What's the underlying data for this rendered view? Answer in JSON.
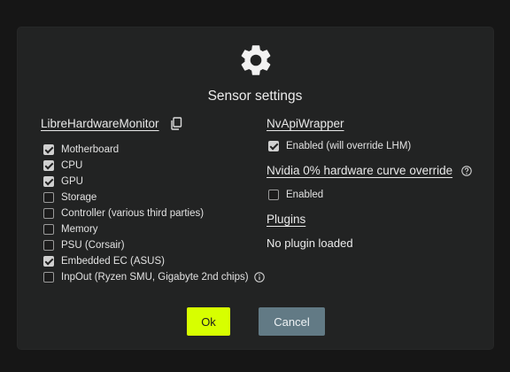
{
  "dialog": {
    "title": "Sensor settings",
    "icon": "gear-icon"
  },
  "left": {
    "heading": "LibreHardwareMonitor",
    "copy_icon": "copy-icon",
    "items": [
      {
        "label": "Motherboard",
        "checked": true
      },
      {
        "label": "CPU",
        "checked": true
      },
      {
        "label": "GPU",
        "checked": true
      },
      {
        "label": "Storage",
        "checked": false
      },
      {
        "label": "Controller (various third parties)",
        "checked": false
      },
      {
        "label": "Memory",
        "checked": false
      },
      {
        "label": "PSU (Corsair)",
        "checked": false
      },
      {
        "label": "Embedded EC (ASUS)",
        "checked": true
      },
      {
        "label": "InpOut (Ryzen SMU, Gigabyte 2nd chips)",
        "checked": false,
        "help_icon": "help-icon"
      }
    ]
  },
  "right": {
    "nvapi": {
      "heading": "NvApiWrapper",
      "option": {
        "label": "Enabled (will override LHM)",
        "checked": true
      }
    },
    "nvidia_curve": {
      "heading": "Nvidia 0% hardware curve override",
      "help_icon": "help-icon",
      "option": {
        "label": "Enabled",
        "checked": false
      }
    },
    "plugins": {
      "heading": "Plugins",
      "status": "No plugin loaded"
    }
  },
  "buttons": {
    "ok_label": "Ok",
    "cancel_label": "Cancel"
  },
  "colors": {
    "accent_ok": "#d7ff00",
    "cancel": "#627a85",
    "dialog_bg": "#222323",
    "page_bg": "#161616"
  }
}
